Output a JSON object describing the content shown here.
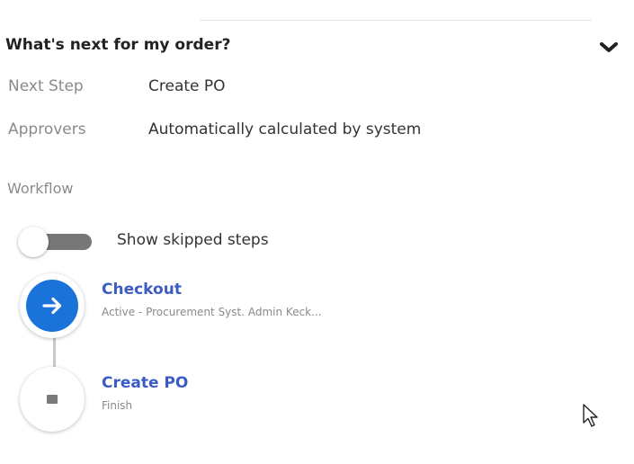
{
  "panel": {
    "title": "What's next for my order?"
  },
  "info": {
    "next_step": {
      "label": "Next Step",
      "value": "Create PO"
    },
    "approvers": {
      "label": "Approvers",
      "value": "Automatically calculated by system"
    }
  },
  "workflow": {
    "label": "Workflow",
    "toggle_label": "Show skipped steps",
    "toggle_on": false,
    "steps": [
      {
        "title": "Checkout",
        "subtitle": "Active - Procurement Syst. Admin Keck...",
        "status": "active",
        "icon": "arrow-right-icon"
      },
      {
        "title": "Create PO",
        "subtitle": "Finish",
        "status": "pending",
        "icon": "stop-square-icon"
      }
    ]
  },
  "colors": {
    "active_step": "#1a73d9",
    "step_title": "#3b5cc4",
    "toggle_track": "#777777"
  }
}
